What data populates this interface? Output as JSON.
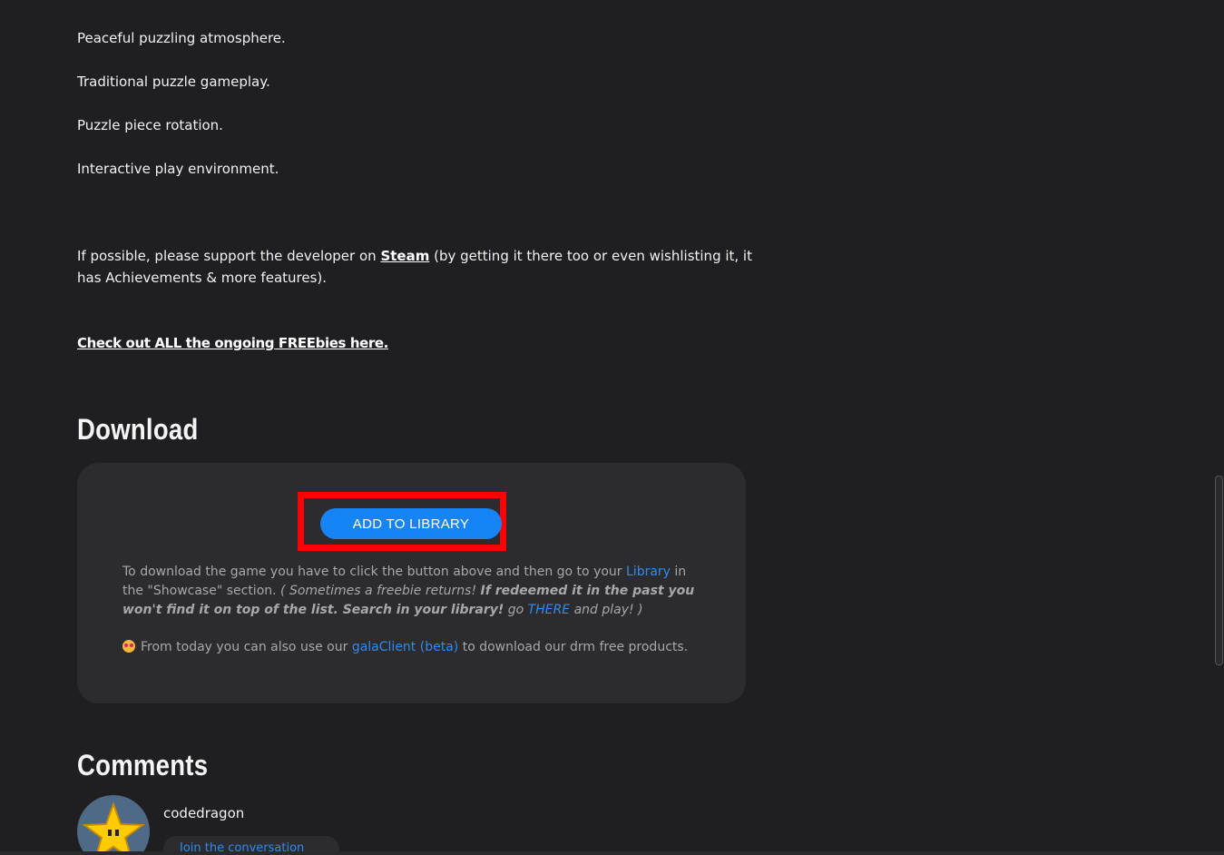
{
  "features": [
    "Peaceful puzzling atmosphere.",
    "Traditional puzzle gameplay.",
    "Puzzle piece rotation.",
    "Interactive play environment."
  ],
  "support": {
    "before": "If possible, please support the developer on ",
    "steam_link": "Steam",
    "after": " (by getting it there too or even wishlisting it, it has Achievements & more features)."
  },
  "freebies_link": "Check out ALL the ongoing FREEbies here.",
  "download": {
    "title": "Download",
    "button_label": "ADD TO LIBRARY",
    "info_1": "To download the game you have to click the button above and then go to your ",
    "library_link": "Library",
    "info_2": " in the \"Showcase\" section. ",
    "info_italic": "( Sometimes a freebie returns! ",
    "info_bold": "If redeemed it in the past you won't find it on top of the list. Search in your library!",
    "info_3": " go ",
    "there_link": "THERE",
    "info_4": " and play! )",
    "client_before": "From today you can also use our ",
    "client_link": "galaClient (beta)",
    "client_after": " to download our drm free products."
  },
  "comments": {
    "title": "Comments",
    "username": "codedragon",
    "reply_label": "Join the conversation"
  },
  "colors": {
    "background": "#1f1e20",
    "panel": "#2c2b2e",
    "accent": "#1784f5",
    "highlight": "#ff0000"
  }
}
